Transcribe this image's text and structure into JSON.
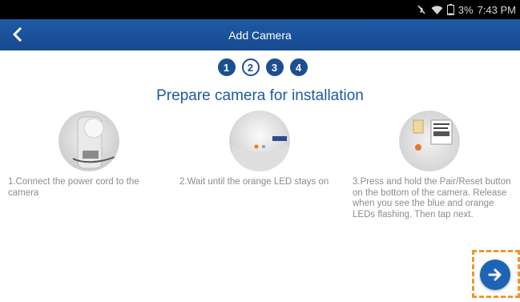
{
  "status_bar": {
    "battery": "3%",
    "time": "7:43 PM"
  },
  "header": {
    "title": "Add Camera",
    "back_icon": "chevron-left-icon"
  },
  "steps": [
    "1",
    "2",
    "3",
    "4"
  ],
  "current_step_index": 1,
  "heading": "Prepare camera for installation",
  "cards": [
    {
      "text": "1.Connect the power cord to the camera",
      "image": "camera-power-cord-image"
    },
    {
      "text": "2.Wait until the orange LED stays on",
      "image": "camera-led-image"
    },
    {
      "text": "3.Press and hold the Pair/Reset button on the bottom of the camera. Release when you see the blue and orange LEDs flashing. Then tap next.",
      "image": "camera-bottom-image"
    }
  ],
  "next": {
    "icon": "arrow-right-icon"
  },
  "colors": {
    "brand_blue": "#1b4f93",
    "heading_blue": "#1d5aa5",
    "highlight_orange": "#f29727",
    "text_gray": "#8c8c8c"
  }
}
